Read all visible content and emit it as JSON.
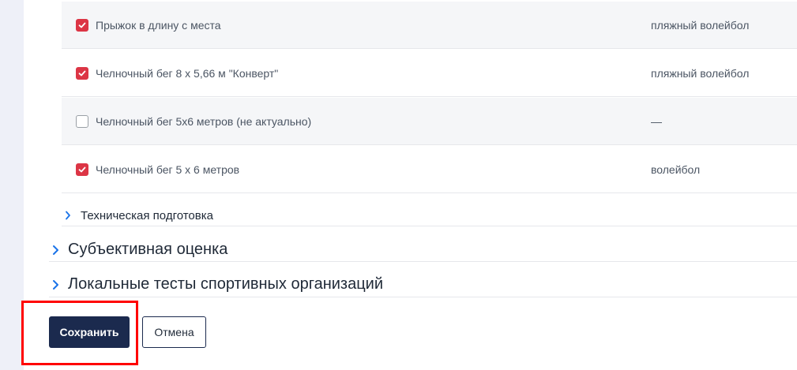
{
  "tests": [
    {
      "name": "Прыжок в длину с места",
      "sport": "пляжный волейбол",
      "checked": true
    },
    {
      "name": "Челночный бег 8 х 5,66 м \"Конверт\"",
      "sport": "пляжный волейбол",
      "checked": true
    },
    {
      "name": "Челночный бег 5х6 метров (не актуально)",
      "sport": "—",
      "checked": false
    },
    {
      "name": "Челночный бег 5 х 6 метров",
      "sport": "волейбол",
      "checked": true
    }
  ],
  "subsection": {
    "label": "Техническая подготовка"
  },
  "sections": [
    {
      "label": "Субъективная оценка"
    },
    {
      "label": "Локальные тесты спортивных организаций"
    }
  ],
  "actions": {
    "save_label": "Сохранить",
    "cancel_label": "Отмена"
  },
  "colors": {
    "checkbox_checked": "#dc3545",
    "primary_button": "#1b2a4e",
    "chevron": "#1a73e8",
    "highlight": "#ff0000"
  }
}
